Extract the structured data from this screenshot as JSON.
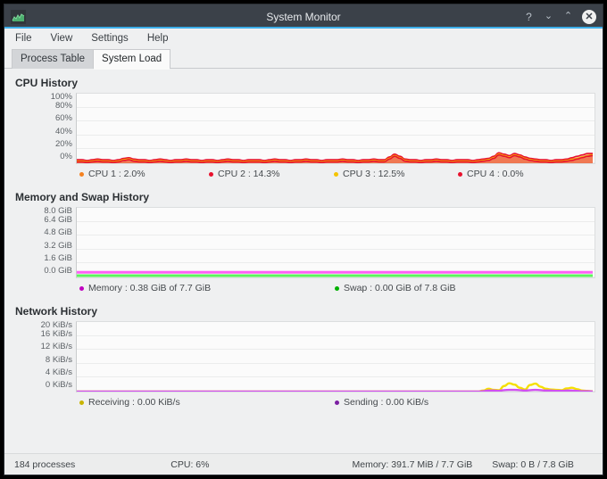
{
  "window": {
    "title": "System Monitor",
    "app_icon": "chart-area-icon",
    "controls": {
      "help_label": "?",
      "minimize_label": "⌄",
      "maximize_label": "⌃",
      "close_label": "✕"
    },
    "accent_color": "#3daee9",
    "titlebar_color": "#3b4149"
  },
  "menubar": {
    "items": [
      {
        "label": "File"
      },
      {
        "label": "View"
      },
      {
        "label": "Settings"
      },
      {
        "label": "Help"
      }
    ]
  },
  "tabs": [
    {
      "label": "Process Table",
      "active": false
    },
    {
      "label": "System Load",
      "active": true
    }
  ],
  "sections": [
    {
      "title": "CPU History",
      "y_labels": [
        "100%",
        "80%",
        "60%",
        "40%",
        "20%",
        "0%"
      ],
      "legend": [
        {
          "label": "CPU 1 : 2.0%",
          "color": "#f58220"
        },
        {
          "label": "CPU 2 : 14.3%",
          "color": "#e8112d"
        },
        {
          "label": "CPU 3 : 12.5%",
          "color": "#f5c400"
        },
        {
          "label": "CPU 4 : 0.0%",
          "color": "#e8112d"
        }
      ]
    },
    {
      "title": "Memory and Swap History",
      "y_labels": [
        "8.0 GiB",
        "6.4 GiB",
        "4.8 GiB",
        "3.2 GiB",
        "1.6 GiB",
        "0.0 GiB"
      ],
      "legend": [
        {
          "label": "Memory : 0.38 GiB of 7.7 GiB",
          "color": "#c000c0"
        },
        {
          "label": "Swap : 0.00 GiB of 7.8 GiB",
          "color": "#00b000"
        }
      ]
    },
    {
      "title": "Network History",
      "y_labels": [
        "20 KiB/s",
        "16 KiB/s",
        "12 KiB/s",
        "8 KiB/s",
        "4 KiB/s",
        "0 KiB/s"
      ],
      "legend": [
        {
          "label": "Receiving : 0.00 KiB/s",
          "color": "#c8b400"
        },
        {
          "label": "Sending : 0.00 KiB/s",
          "color": "#7b1fa2"
        }
      ]
    }
  ],
  "statusbar": {
    "processes": "184 processes",
    "cpu": "CPU: 6%",
    "memory": "Memory: 391.7 MiB / 7.7 GiB",
    "swap": "Swap: 0 B / 7.8 GiB"
  },
  "chart_data": [
    {
      "type": "area",
      "title": "CPU History",
      "ylabel": "",
      "ylim": [
        0,
        100
      ],
      "yticks": [
        0,
        20,
        40,
        60,
        80,
        100
      ],
      "ytick_labels": [
        "0%",
        "20%",
        "40%",
        "60%",
        "80%",
        "100%"
      ],
      "grid": true,
      "legend_position": "bottom",
      "series": [
        {
          "name": "CPU 1",
          "current_value": 2.0,
          "unit": "%",
          "color": "#f58220",
          "values": [
            4,
            4,
            3,
            4,
            5,
            4,
            4,
            3,
            4,
            6,
            7,
            5,
            4,
            4,
            3,
            4,
            5,
            4,
            3,
            4,
            4,
            5,
            4,
            4,
            3,
            4,
            4,
            3,
            4,
            5,
            4,
            4,
            3,
            4,
            4,
            4,
            3,
            4,
            5,
            4,
            4,
            3,
            4,
            4,
            5,
            4,
            4,
            3,
            4,
            4,
            4,
            5,
            4,
            4,
            3,
            4,
            4,
            5,
            4,
            4,
            8,
            12,
            9,
            5,
            4,
            4,
            3,
            4,
            4,
            5,
            4,
            4,
            3,
            4,
            4,
            4,
            3,
            4,
            5,
            6,
            9,
            14,
            12,
            10,
            13,
            11,
            8,
            6,
            5,
            4,
            4,
            3,
            4,
            4,
            5,
            6,
            7,
            9,
            11,
            13
          ]
        },
        {
          "name": "CPU 2",
          "current_value": 14.3,
          "unit": "%",
          "color": "#e8112d",
          "values": [
            5,
            5,
            4,
            5,
            6,
            5,
            5,
            4,
            5,
            7,
            8,
            6,
            5,
            5,
            4,
            5,
            6,
            5,
            4,
            5,
            5,
            6,
            5,
            5,
            4,
            5,
            5,
            4,
            5,
            6,
            5,
            5,
            4,
            5,
            5,
            5,
            4,
            5,
            6,
            5,
            5,
            4,
            5,
            5,
            6,
            5,
            5,
            4,
            5,
            5,
            5,
            6,
            5,
            5,
            4,
            5,
            5,
            6,
            5,
            5,
            9,
            13,
            10,
            6,
            5,
            5,
            4,
            5,
            5,
            6,
            5,
            5,
            4,
            5,
            5,
            5,
            4,
            5,
            6,
            7,
            10,
            15,
            13,
            11,
            14,
            12,
            9,
            7,
            6,
            5,
            5,
            4,
            5,
            5,
            6,
            8,
            10,
            12,
            14,
            14
          ]
        },
        {
          "name": "CPU 3",
          "current_value": 12.5,
          "unit": "%",
          "color": "#f5c400",
          "values": [
            3,
            3,
            2,
            3,
            4,
            3,
            3,
            2,
            3,
            5,
            6,
            4,
            3,
            3,
            2,
            3,
            4,
            3,
            2,
            3,
            3,
            4,
            3,
            3,
            2,
            3,
            3,
            2,
            3,
            4,
            3,
            3,
            2,
            3,
            3,
            3,
            2,
            3,
            4,
            3,
            3,
            2,
            3,
            3,
            4,
            3,
            3,
            2,
            3,
            3,
            3,
            4,
            3,
            3,
            2,
            3,
            3,
            4,
            3,
            3,
            7,
            11,
            8,
            4,
            3,
            3,
            2,
            3,
            3,
            4,
            3,
            3,
            2,
            3,
            3,
            3,
            2,
            3,
            4,
            5,
            8,
            13,
            11,
            9,
            12,
            10,
            7,
            5,
            4,
            3,
            3,
            2,
            3,
            3,
            4,
            5,
            7,
            9,
            11,
            12
          ]
        },
        {
          "name": "CPU 4",
          "current_value": 0.0,
          "unit": "%",
          "color": "#e8112d",
          "values": [
            2,
            2,
            1,
            2,
            3,
            2,
            2,
            1,
            2,
            4,
            5,
            3,
            2,
            2,
            1,
            2,
            3,
            2,
            1,
            2,
            2,
            3,
            2,
            2,
            1,
            2,
            2,
            1,
            2,
            3,
            2,
            2,
            1,
            2,
            2,
            2,
            1,
            2,
            3,
            2,
            2,
            1,
            2,
            2,
            3,
            2,
            2,
            1,
            2,
            2,
            2,
            3,
            2,
            2,
            1,
            2,
            2,
            3,
            2,
            2,
            6,
            10,
            7,
            3,
            2,
            2,
            1,
            2,
            2,
            3,
            2,
            2,
            1,
            2,
            2,
            2,
            1,
            2,
            3,
            4,
            7,
            12,
            10,
            8,
            11,
            9,
            6,
            4,
            3,
            2,
            2,
            1,
            2,
            2,
            3,
            4,
            6,
            8,
            10,
            11
          ]
        }
      ]
    },
    {
      "type": "area",
      "title": "Memory and Swap History",
      "ylabel": "",
      "ylim": [
        0,
        8.0
      ],
      "yticks": [
        0.0,
        1.6,
        3.2,
        4.8,
        6.4,
        8.0
      ],
      "ytick_labels": [
        "0.0 GiB",
        "1.6 GiB",
        "3.2 GiB",
        "4.8 GiB",
        "6.4 GiB",
        "8.0 GiB"
      ],
      "grid": true,
      "legend_position": "bottom",
      "series": [
        {
          "name": "Memory",
          "current_value": 0.38,
          "total": 7.7,
          "unit": "GiB",
          "color": "#ff5ff5",
          "values": [
            0.38,
            0.38,
            0.38,
            0.38,
            0.38,
            0.38,
            0.38,
            0.38,
            0.38,
            0.38,
            0.38,
            0.38,
            0.38,
            0.38,
            0.38,
            0.38,
            0.38,
            0.38,
            0.38,
            0.38,
            0.38,
            0.38,
            0.38,
            0.38,
            0.38,
            0.38,
            0.38,
            0.38,
            0.38,
            0.38,
            0.38,
            0.38,
            0.38,
            0.38,
            0.38,
            0.38,
            0.38,
            0.38,
            0.38,
            0.38,
            0.38,
            0.38,
            0.38,
            0.38,
            0.38,
            0.38,
            0.38,
            0.38,
            0.38,
            0.38
          ]
        },
        {
          "name": "Swap",
          "current_value": 0.0,
          "total": 7.8,
          "unit": "GiB",
          "color": "#5cf55c",
          "values": [
            0,
            0,
            0,
            0,
            0,
            0,
            0,
            0,
            0,
            0,
            0,
            0,
            0,
            0,
            0,
            0,
            0,
            0,
            0,
            0,
            0,
            0,
            0,
            0,
            0,
            0,
            0,
            0,
            0,
            0,
            0,
            0,
            0,
            0,
            0,
            0,
            0,
            0,
            0,
            0,
            0,
            0,
            0,
            0,
            0,
            0,
            0,
            0,
            0,
            0
          ]
        }
      ]
    },
    {
      "type": "area",
      "title": "Network History",
      "ylabel": "",
      "ylim": [
        0,
        20
      ],
      "yticks": [
        0,
        4,
        8,
        12,
        16,
        20
      ],
      "ytick_labels": [
        "0 KiB/s",
        "4 KiB/s",
        "8 KiB/s",
        "12 KiB/s",
        "16 KiB/s",
        "20 KiB/s"
      ],
      "grid": true,
      "legend_position": "bottom",
      "series": [
        {
          "name": "Receiving",
          "current_value": 0.0,
          "unit": "KiB/s",
          "color": "#f5e000",
          "values": [
            0,
            0,
            0,
            0,
            0,
            0,
            0,
            0,
            0,
            0,
            0,
            0,
            0,
            0,
            0,
            0,
            0,
            0,
            0,
            0,
            0,
            0,
            0,
            0,
            0,
            0,
            0,
            0,
            0,
            0,
            0,
            0,
            0,
            0,
            0,
            0,
            0,
            0,
            0,
            0,
            0,
            0,
            0,
            0,
            0,
            0,
            0,
            0,
            0,
            0,
            0,
            0,
            0,
            0,
            0,
            0,
            0,
            0,
            0,
            0,
            0,
            0,
            0,
            0,
            0,
            0,
            0,
            0,
            0,
            0,
            0,
            0,
            0,
            0,
            0,
            0,
            0,
            0,
            0.3,
            0.8,
            0.5,
            0.4,
            1.6,
            2.4,
            2.0,
            1.1,
            0.6,
            1.9,
            2.3,
            1.4,
            0.8,
            0.6,
            0.5,
            0.4,
            0.9,
            1.1,
            0.7,
            0.3,
            0.2,
            0.1
          ]
        },
        {
          "name": "Sending",
          "current_value": 0.0,
          "unit": "KiB/s",
          "color": "#d050f0",
          "values": [
            0,
            0,
            0,
            0,
            0,
            0,
            0,
            0,
            0,
            0,
            0,
            0,
            0,
            0,
            0,
            0,
            0,
            0,
            0,
            0,
            0,
            0,
            0,
            0,
            0,
            0,
            0,
            0,
            0,
            0,
            0,
            0,
            0,
            0,
            0,
            0,
            0,
            0,
            0,
            0,
            0,
            0,
            0,
            0,
            0,
            0,
            0,
            0,
            0,
            0,
            0,
            0,
            0,
            0,
            0,
            0,
            0,
            0,
            0,
            0,
            0,
            0,
            0,
            0,
            0,
            0,
            0,
            0,
            0,
            0,
            0,
            0,
            0,
            0,
            0,
            0,
            0,
            0,
            0.1,
            0.3,
            0.3,
            0.2,
            0.4,
            0.5,
            0.5,
            0.4,
            0.3,
            0.4,
            0.5,
            0.4,
            0.3,
            0.3,
            0.2,
            0.2,
            0.3,
            0.3,
            0.2,
            0.1,
            0.1,
            0.05
          ]
        }
      ]
    }
  ]
}
